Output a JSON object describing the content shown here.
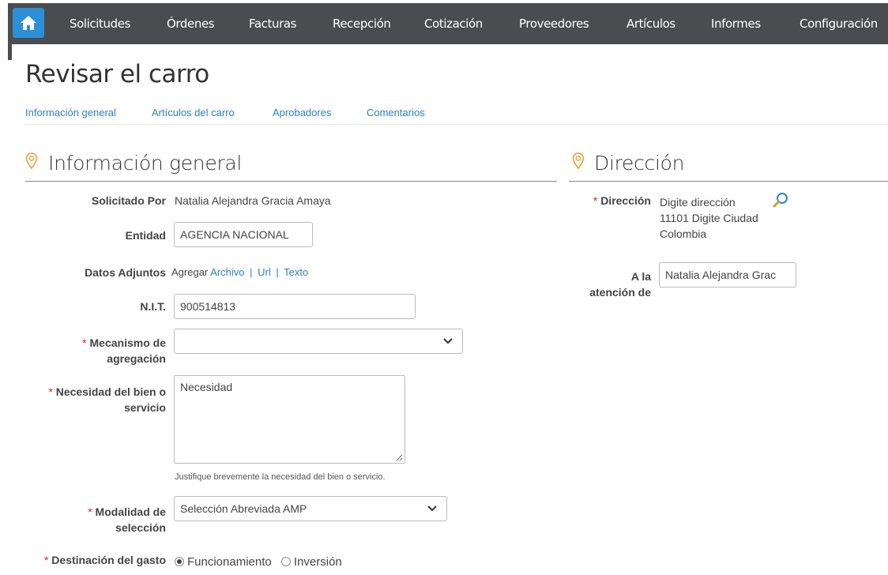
{
  "nav": {
    "items": [
      "Solicitudes",
      "Órdenes",
      "Facturas",
      "Recepción",
      "Cotización",
      "Proveedores",
      "Artículos",
      "Informes",
      "Configuración"
    ]
  },
  "page": {
    "title": "Revisar el carro"
  },
  "subnav": [
    "Información general",
    "Artículos del carro",
    "Aprobadores",
    "Comentarios"
  ],
  "general": {
    "title": "Información general",
    "solicitado_label": "Solicitado Por",
    "solicitado_value": "Natalia Alejandra Gracia Amaya",
    "entidad_label": "Entidad",
    "entidad_value": "AGENCIA NACIONAL",
    "adjuntos_label": "Datos Adjuntos",
    "adjuntos_prefix": "Agregar",
    "adjuntos_archivo": "Archivo",
    "adjuntos_url": "Url",
    "adjuntos_texto": "Texto",
    "adjuntos_sep": "|",
    "nit_label": "N.I.T.",
    "nit_value": "900514813",
    "mecanismo_label_1": "Mecanismo de",
    "mecanismo_label_2": "agregación",
    "mecanismo_value": "",
    "necesidad_label_1": "Necesidad del bien o",
    "necesidad_label_2": "servicio",
    "necesidad_value": "Necesidad",
    "necesidad_help": "Justifique brevemente la necesidad del bien o servicio.",
    "modalidad_label_1": "Modalidad de",
    "modalidad_label_2": "selección",
    "modalidad_value": "Selección Abreviada AMP",
    "destinacion_label": "Destinación del gasto",
    "destinacion_options": [
      "Funcionamiento",
      "Inversión"
    ],
    "destinacion_selected": "Funcionamiento",
    "required_mark": "*"
  },
  "direccion": {
    "title": "Dirección",
    "label": "Dirección",
    "line1": "Digite dirección",
    "line2": "11101 Digite Ciudad",
    "line3": "Colombia",
    "atencion_label_1": "A la",
    "atencion_label_2": "atención de",
    "atencion_value": "Natalia Alejandra Grac"
  },
  "colors": {
    "nav_bg": "#4a4c50",
    "home_bg": "#2d8fd5",
    "link": "#2b82c8",
    "pin": "#f0a030",
    "required": "#d62020"
  }
}
